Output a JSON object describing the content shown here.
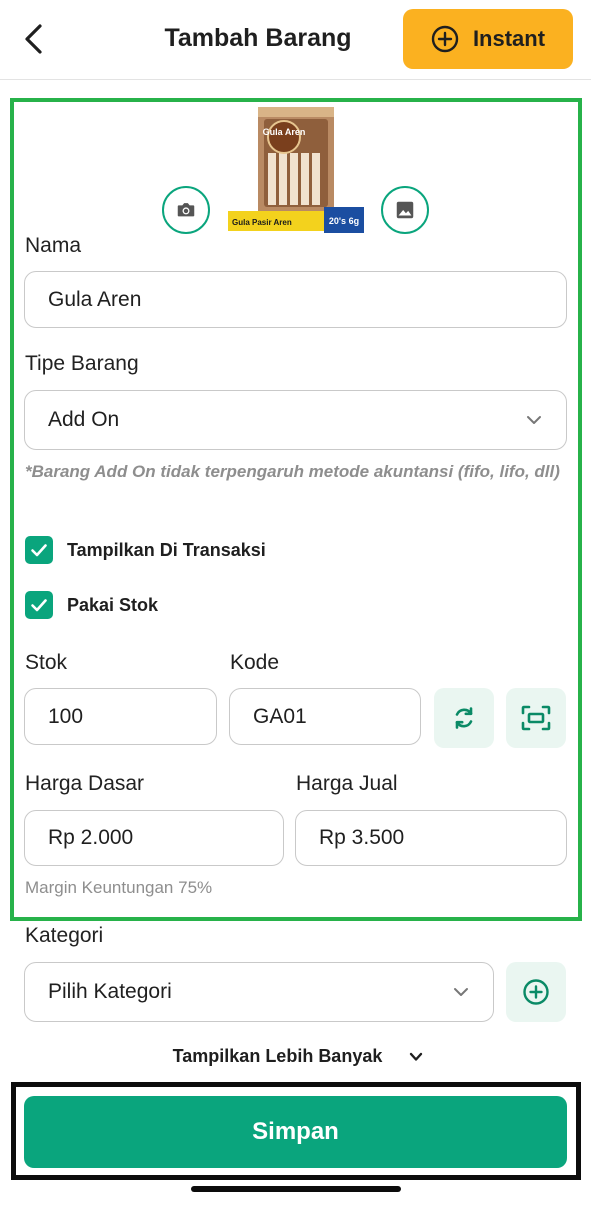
{
  "header": {
    "title": "Tambah Barang",
    "back_icon": "chevron-left-icon",
    "instant_label": "Instant",
    "instant_icon": "plus-circle-icon"
  },
  "product_image": {
    "brand_title": "Gula Aren",
    "pack_text": "Gula Pasir Aren",
    "size_badge": "20's 6g",
    "camera_icon": "camera-icon",
    "gallery_icon": "image-icon"
  },
  "form": {
    "nama": {
      "label": "Nama",
      "value": "Gula Aren"
    },
    "tipe_barang": {
      "label": "Tipe Barang",
      "value": "Add On",
      "note": "*Barang Add On tidak terpengaruh metode akuntansi (fifo, lifo, dll)"
    },
    "checkboxes": [
      {
        "label": "Tampilkan Di Transaksi",
        "checked": true
      },
      {
        "label": "Pakai Stok",
        "checked": true
      }
    ],
    "stok": {
      "label": "Stok",
      "value": "100"
    },
    "kode": {
      "label": "Kode",
      "value": "GA01"
    },
    "harga_dasar": {
      "label": "Harga Dasar",
      "value": "Rp 2.000"
    },
    "harga_jual": {
      "label": "Harga Jual",
      "value": "Rp 3.500"
    },
    "margin_text": "Margin Keuntungan 75%",
    "kategori": {
      "label": "Kategori",
      "placeholder": "Pilih Kategori"
    }
  },
  "more_label": "Tampilkan Lebih Banyak",
  "save_label": "Simpan",
  "colors": {
    "accent": "#0aa57d",
    "instant": "#fbb120",
    "highlight_green": "#27b24a",
    "highlight_black": "#0c0c0c"
  }
}
